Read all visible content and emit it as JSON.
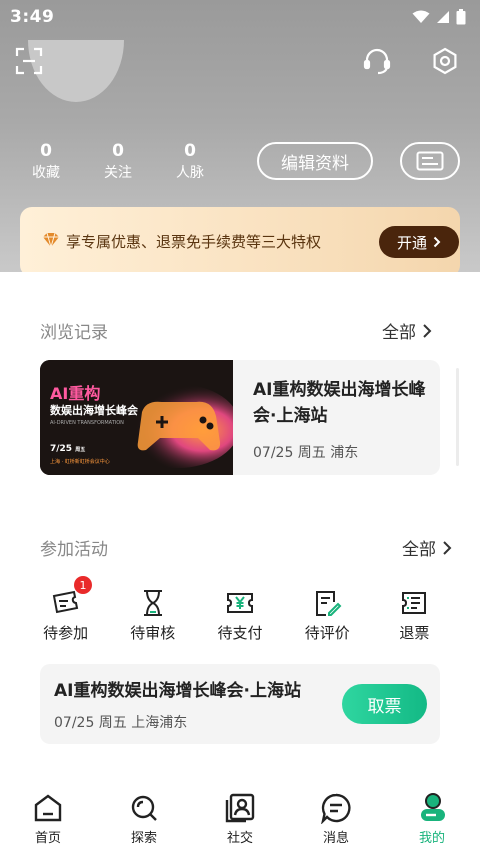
{
  "status_bar": {
    "time": "3:49"
  },
  "profile": {
    "stats": [
      {
        "count": "0",
        "label": "收藏"
      },
      {
        "count": "0",
        "label": "关注"
      },
      {
        "count": "0",
        "label": "人脉"
      }
    ],
    "edit_label": "编辑资料"
  },
  "vip": {
    "text": "享专属优惠、退票免手续费等三大特权",
    "button": "开通"
  },
  "history": {
    "title": "浏览记录",
    "all_label": "全部",
    "item": {
      "title": "AI重构数娱出海增长峰会·上海站",
      "meta": "07/25 周五  浦东",
      "poster": {
        "headline_a": "AI重构",
        "headline_b": "数娱出海增长峰会",
        "subline": "AI-DRIVEN TRANSFORMATION",
        "date": "7/25",
        "day": "周五",
        "place": "上海 · 虹桥新虹桥会议中心"
      }
    }
  },
  "activities": {
    "title": "参加活动",
    "all_label": "全部",
    "statuses": [
      {
        "label": "待参加",
        "icon": "ticket-pending-icon",
        "badge": "1"
      },
      {
        "label": "待审核",
        "icon": "hourglass-icon"
      },
      {
        "label": "待支付",
        "icon": "yen-ticket-icon"
      },
      {
        "label": "待评价",
        "icon": "review-icon"
      },
      {
        "label": "退票",
        "icon": "refund-ticket-icon"
      }
    ],
    "ticket": {
      "title": "AI重构数娱出海增长峰会·上海站",
      "meta": "07/25 周五  上海浦东",
      "button": "取票"
    }
  },
  "tabbar": {
    "items": [
      {
        "label": "首页",
        "icon": "home-icon"
      },
      {
        "label": "探索",
        "icon": "search-icon"
      },
      {
        "label": "社交",
        "icon": "social-icon"
      },
      {
        "label": "消息",
        "icon": "message-icon"
      },
      {
        "label": "我的",
        "icon": "profile-icon",
        "active": true
      }
    ]
  },
  "colors": {
    "accent": "#19b37c",
    "vip_button": "#4a250c",
    "badge": "#e92a2a"
  }
}
